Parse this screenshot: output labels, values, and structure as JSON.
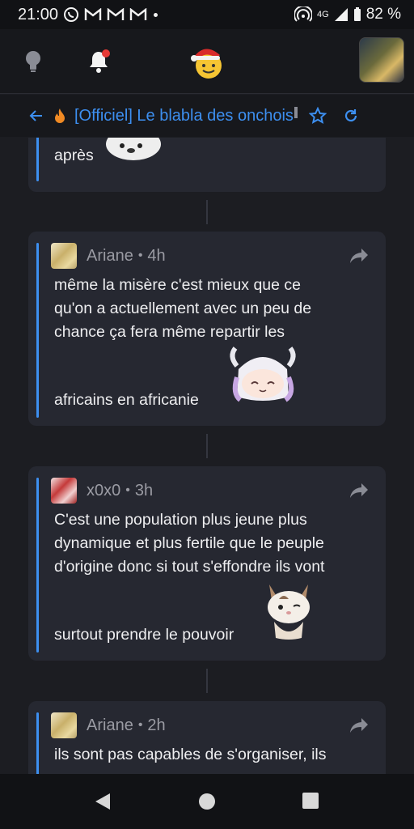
{
  "status": {
    "time": "21:00",
    "network": "4G",
    "battery": "82 %"
  },
  "header": {
    "icons": [
      "lightbulb-icon",
      "bell-icon",
      "santa-smiley-logo",
      "user-avatar"
    ]
  },
  "topic": {
    "title": "[Officiel] Le blabla des onchois"
  },
  "feed": {
    "partial_post": {
      "text": "après"
    },
    "posts": [
      {
        "author": "Ariane",
        "time": "4h",
        "lines": [
          "même la misère c'est mieux que ce",
          "qu'on a actuellement avec un peu de",
          "chance ça fera même repartir les",
          "africains en africanie"
        ]
      },
      {
        "author": "x0x0",
        "time": "3h",
        "lines": [
          "C'est une population plus jeune plus",
          "dynamique et plus fertile que le peuple",
          "d'origine donc si tout s'effondre ils vont",
          "surtout prendre le pouvoir"
        ]
      },
      {
        "author": "Ariane",
        "time": "2h",
        "lines": [
          "ils sont pas capables de s'organiser, ils"
        ]
      }
    ]
  },
  "colors": {
    "accent": "#3d8ff0",
    "background": "#1c1d22",
    "card": "#262831",
    "bell_badge": "#e53935",
    "flame": "#f08a24"
  }
}
